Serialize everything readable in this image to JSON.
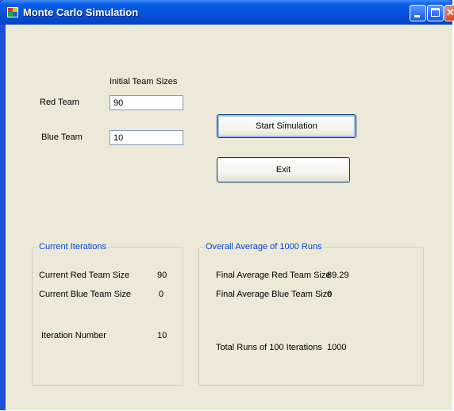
{
  "window": {
    "title": "Monte Carlo Simulation"
  },
  "setup": {
    "initial_team_sizes_label": "Initial Team Sizes",
    "red_team_label": "Red Team",
    "red_team_value": "90",
    "blue_team_label": "Blue Team",
    "blue_team_value": "10"
  },
  "buttons": {
    "start_label": "Start Simulation",
    "exit_label": "Exit"
  },
  "current_iterations": {
    "title": "Current Iterations",
    "red_label": "Current Red Team Size",
    "red_value": "90",
    "blue_label": "Current Blue Team Size",
    "blue_value": "0",
    "iteration_label": "Iteration Number",
    "iteration_value": "10"
  },
  "overall_average": {
    "title": "Overall Average of 1000 Runs",
    "red_label": "Final Average Red Team Size",
    "red_value": "89.29",
    "blue_label": "Final Average Blue Team Size",
    "blue_value": "0",
    "total_label": "Total Runs of 100 Iterations",
    "total_value": "1000"
  }
}
